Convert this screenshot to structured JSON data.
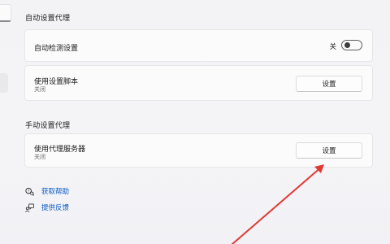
{
  "auto_proxy": {
    "section_title": "自动设置代理",
    "detect": {
      "label": "自动检测设置",
      "state_text": "关",
      "on": false
    },
    "script": {
      "label": "使用设置脚本",
      "status": "关闭",
      "button": "设置"
    }
  },
  "manual_proxy": {
    "section_title": "手动设置代理",
    "server": {
      "label": "使用代理服务器",
      "status": "关闭",
      "button": "设置"
    }
  },
  "links": {
    "help": "获取帮助",
    "feedback": "提供反馈"
  },
  "colors": {
    "link": "#0a5ac2",
    "annotation_arrow": "#e03a35"
  }
}
